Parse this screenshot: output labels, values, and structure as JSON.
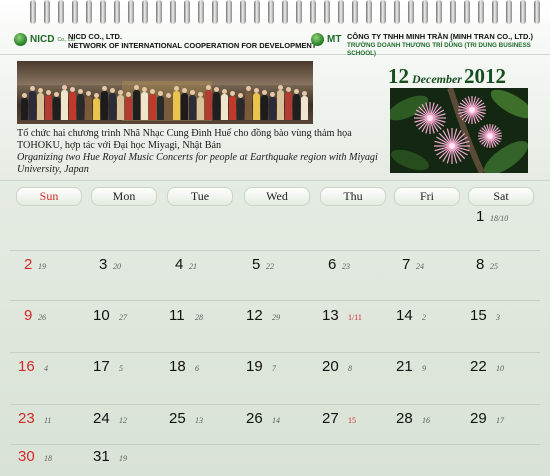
{
  "header": {
    "left_logo": "NICD",
    "left_logo_small": "Co., Ltd",
    "left_org_line1": "NICD CO., LTD.",
    "left_org_line2": "NETWORK OF INTERNATIONAL COOPERATION FOR DEVELOPMENT",
    "right_logo": "MT",
    "right_org_line1": "CÔNG TY TNHH MINH TRẦN (MINH TRAN CO., LTD.)",
    "right_org_line2": "TRƯỜNG DOANH THƯƠNG TRÍ DŨNG (TRI DUNG BUSINESS SCHOOL)"
  },
  "caption": {
    "vn": "Tổ chức hai chương trình Nhã Nhạc Cung Đình Huế cho đồng bào vùng thảm họa TOHOKU, hợp tác với Đại học Miyagi, Nhật Bản",
    "en": "Organizing two Hue Royal Music Concerts for people at Earthquake region with Miyagi University, Japan"
  },
  "date_title": {
    "day": "12",
    "month": "December",
    "year": "2012"
  },
  "images": {
    "photo": "group-photo-concert",
    "flower": "pink-flower-blossom"
  },
  "colors": {
    "sunday": "#d22a2a",
    "title": "#174d1f",
    "background": "#dde6db"
  },
  "weekdays": [
    "Sun",
    "Mon",
    "Tue",
    "Wed",
    "Thu",
    "Fri",
    "Sat"
  ],
  "weeks": [
    [
      null,
      null,
      null,
      null,
      null,
      null,
      {
        "day": "1",
        "lunar": "18/10"
      }
    ],
    [
      {
        "day": "2",
        "lunar": "19"
      },
      {
        "day": "3",
        "lunar": "20"
      },
      {
        "day": "4",
        "lunar": "21"
      },
      {
        "day": "5",
        "lunar": "22"
      },
      {
        "day": "6",
        "lunar": "23"
      },
      {
        "day": "7",
        "lunar": "24"
      },
      {
        "day": "8",
        "lunar": "25"
      }
    ],
    [
      {
        "day": "9",
        "lunar": "26"
      },
      {
        "day": "10",
        "lunar": "27"
      },
      {
        "day": "11",
        "lunar": "28"
      },
      {
        "day": "12",
        "lunar": "29"
      },
      {
        "day": "13",
        "lunar": "1/11",
        "lunar_red": true
      },
      {
        "day": "14",
        "lunar": "2"
      },
      {
        "day": "15",
        "lunar": "3"
      }
    ],
    [
      {
        "day": "16",
        "lunar": "4"
      },
      {
        "day": "17",
        "lunar": "5"
      },
      {
        "day": "18",
        "lunar": "6"
      },
      {
        "day": "19",
        "lunar": "7"
      },
      {
        "day": "20",
        "lunar": "8"
      },
      {
        "day": "21",
        "lunar": "9"
      },
      {
        "day": "22",
        "lunar": "10"
      }
    ],
    [
      {
        "day": "23",
        "lunar": "11"
      },
      {
        "day": "24",
        "lunar": "12"
      },
      {
        "day": "25",
        "lunar": "13"
      },
      {
        "day": "26",
        "lunar": "14"
      },
      {
        "day": "27",
        "lunar": "15",
        "lunar_red": true
      },
      {
        "day": "28",
        "lunar": "16"
      },
      {
        "day": "29",
        "lunar": "17"
      }
    ],
    [
      {
        "day": "30",
        "lunar": "18"
      },
      {
        "day": "31",
        "lunar": "19"
      },
      null,
      null,
      null,
      null,
      null
    ]
  ]
}
